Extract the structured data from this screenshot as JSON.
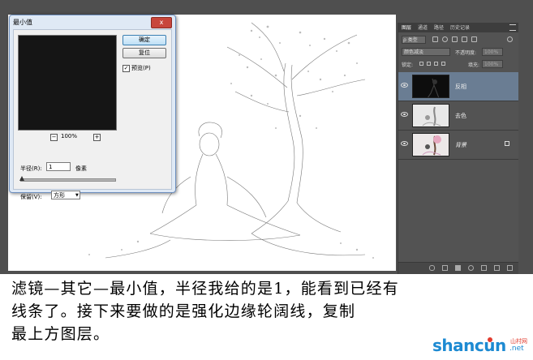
{
  "dialog": {
    "title": "最小值",
    "close_label": "x",
    "ok_label": "确定",
    "reset_label": "复位",
    "preview_label": "预览(P)",
    "preview_checked": "✓",
    "zoom_out": "−",
    "zoom_in": "+",
    "zoom_level": "100%",
    "radius_label": "半径(R):",
    "radius_value": "1",
    "radius_unit": "像素",
    "preserve_label": "保留(V):",
    "preserve_value": "方形"
  },
  "layers_panel": {
    "tabs": [
      "图层",
      "通道",
      "路径",
      "历史记录"
    ],
    "filter_label": "ρ 类型",
    "blend_mode": "颜色减淡",
    "opacity_label": "不透明度:",
    "opacity_value": "100%",
    "lock_label": "锁定:",
    "fill_label": "填充:",
    "fill_value": "100%",
    "layers": [
      {
        "name": "反相",
        "selected": true
      },
      {
        "name": "去色",
        "selected": false
      },
      {
        "name": "背景",
        "selected": false,
        "locked": true
      }
    ],
    "bottom_icons": [
      "link-icon",
      "fx-icon",
      "mask-icon",
      "adjustment-icon",
      "group-icon",
      "new-layer-icon",
      "trash-icon"
    ]
  },
  "caption": {
    "line1": "滤镜—其它—最小值，半径我给的是1，能看到已经有",
    "line2": "线条了。接下来要做的是强化边缘轮阔线，复制",
    "line3": "最上方图层。"
  },
  "watermark": {
    "main": "shancun",
    "net": ".net",
    "cn": "山村网"
  }
}
